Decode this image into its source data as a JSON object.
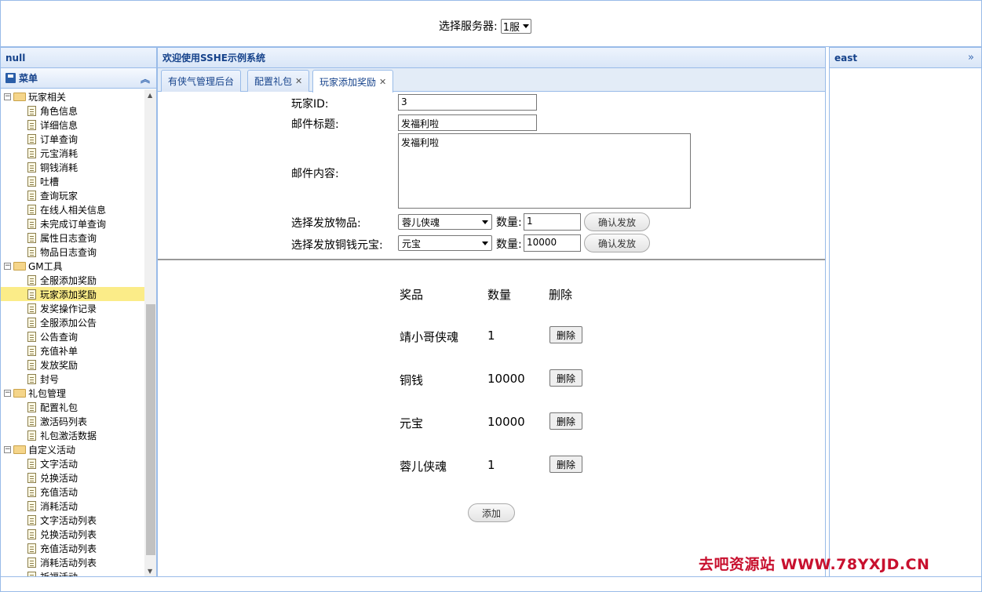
{
  "header": {
    "server_label": "选择服务器:",
    "server_value": "1服"
  },
  "west": {
    "title": "null",
    "menu_title": "菜单",
    "tree": [
      {
        "label": "玩家相关",
        "type": "group"
      },
      {
        "label": "角色信息",
        "type": "leaf"
      },
      {
        "label": "详细信息",
        "type": "leaf"
      },
      {
        "label": "订单查询",
        "type": "leaf"
      },
      {
        "label": "元宝消耗",
        "type": "leaf"
      },
      {
        "label": "铜钱消耗",
        "type": "leaf"
      },
      {
        "label": "吐槽",
        "type": "leaf"
      },
      {
        "label": "查询玩家",
        "type": "leaf"
      },
      {
        "label": "在线人相关信息",
        "type": "leaf"
      },
      {
        "label": "未完成订单查询",
        "type": "leaf"
      },
      {
        "label": "属性日志查询",
        "type": "leaf"
      },
      {
        "label": "物品日志查询",
        "type": "leaf"
      },
      {
        "label": "GM工具",
        "type": "group"
      },
      {
        "label": "全服添加奖励",
        "type": "leaf"
      },
      {
        "label": "玩家添加奖励",
        "type": "leaf",
        "selected": true
      },
      {
        "label": "发奖操作记录",
        "type": "leaf"
      },
      {
        "label": "全服添加公告",
        "type": "leaf"
      },
      {
        "label": "公告查询",
        "type": "leaf"
      },
      {
        "label": "充值补单",
        "type": "leaf"
      },
      {
        "label": "发放奖励",
        "type": "leaf"
      },
      {
        "label": "封号",
        "type": "leaf"
      },
      {
        "label": "礼包管理",
        "type": "group"
      },
      {
        "label": "配置礼包",
        "type": "leaf"
      },
      {
        "label": "激活码列表",
        "type": "leaf"
      },
      {
        "label": "礼包激活数据",
        "type": "leaf"
      },
      {
        "label": "自定义活动",
        "type": "group"
      },
      {
        "label": "文字活动",
        "type": "leaf"
      },
      {
        "label": "兑换活动",
        "type": "leaf"
      },
      {
        "label": "充值活动",
        "type": "leaf"
      },
      {
        "label": "消耗活动",
        "type": "leaf"
      },
      {
        "label": "文字活动列表",
        "type": "leaf"
      },
      {
        "label": "兑换活动列表",
        "type": "leaf"
      },
      {
        "label": "充值活动列表",
        "type": "leaf"
      },
      {
        "label": "消耗活动列表",
        "type": "leaf"
      },
      {
        "label": "祈福活动",
        "type": "leaf"
      }
    ]
  },
  "center": {
    "title": "欢迎使用SSHE示例系统",
    "tabs": [
      {
        "label": "有侠气管理后台",
        "closable": false
      },
      {
        "label": "配置礼包",
        "closable": true
      },
      {
        "label": "玩家添加奖励",
        "closable": true,
        "active": true
      }
    ],
    "form": {
      "player_id_label": "玩家ID:",
      "player_id_value": "3",
      "mail_title_label": "邮件标题:",
      "mail_title_value": "发福利啦",
      "mail_content_label": "邮件内容:",
      "mail_content_value": "发福利啦",
      "item_label": "选择发放物品:",
      "item_value": "蓉儿侠魂",
      "item_qty_label": "数量:",
      "item_qty_value": "1",
      "item_confirm": "确认发放",
      "currency_label": "选择发放铜钱元宝:",
      "currency_value": "元宝",
      "currency_qty_label": "数量:",
      "currency_qty_value": "10000",
      "currency_confirm": "确认发放"
    },
    "rewards": {
      "headers": [
        "奖品",
        "数量",
        "删除"
      ],
      "rows": [
        {
          "name": "靖小哥侠魂",
          "qty": "1"
        },
        {
          "name": "铜钱",
          "qty": "10000"
        },
        {
          "name": "元宝",
          "qty": "10000"
        },
        {
          "name": "蓉儿侠魂",
          "qty": "1"
        }
      ],
      "delete_label": "删除",
      "add_label": "添加"
    }
  },
  "east": {
    "title": "east"
  },
  "watermark": "去吧资源站 WWW.78YXJD.CN",
  "colors": {
    "border": "#99bbe8",
    "header_text": "#15428b",
    "selected_row": "#fbec88",
    "watermark": "#c8102e"
  }
}
